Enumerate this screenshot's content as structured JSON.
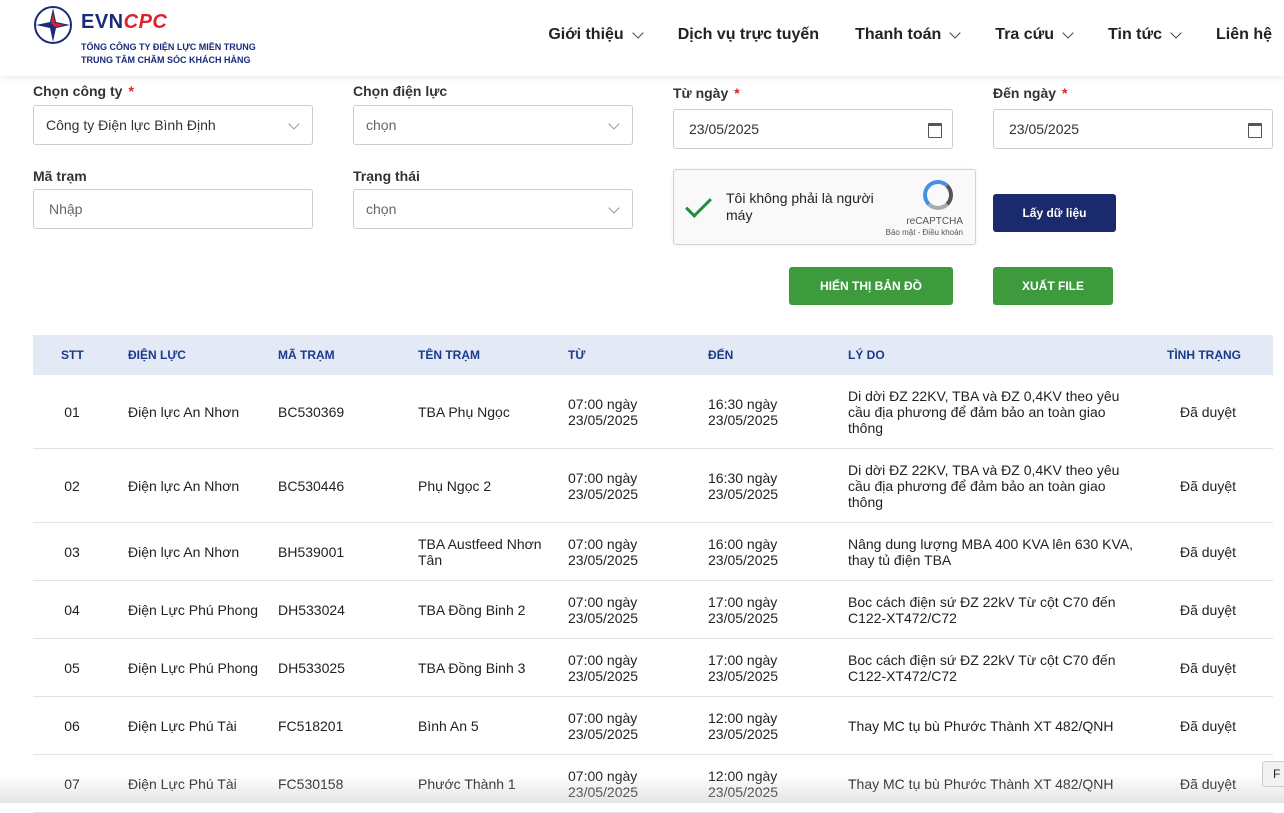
{
  "header": {
    "logo_evn": "EVN",
    "logo_cpc": "CPC",
    "logo_sub1": "TỔNG CÔNG TY ĐIỆN LỰC MIỀN TRUNG",
    "logo_sub2": "TRUNG TÂM CHĂM SÓC KHÁCH HÀNG",
    "nav": [
      {
        "label": "Giới thiệu",
        "dropdown": true
      },
      {
        "label": "Dịch vụ trực tuyến",
        "dropdown": false
      },
      {
        "label": "Thanh toán",
        "dropdown": true
      },
      {
        "label": "Tra cứu",
        "dropdown": true
      },
      {
        "label": "Tin tức",
        "dropdown": true
      },
      {
        "label": "Liên hệ",
        "dropdown": false
      }
    ]
  },
  "filters": {
    "company_label": "Chọn công ty",
    "company_value": "Công ty Điện lực Bình Định",
    "branch_label": "Chọn điện lực",
    "branch_value": "chọn",
    "from_label": "Từ ngày",
    "from_value": "23/05/2025",
    "to_label": "Đến ngày",
    "to_value": "23/05/2025",
    "station_label": "Mã trạm",
    "station_placeholder": "Nhập",
    "status_label": "Trạng thái",
    "status_value": "chọn",
    "required_mark": "*"
  },
  "captcha": {
    "text": "Tôi không phải là người máy",
    "brand": "reCAPTCHA",
    "links": "Bảo mật - Điều khoản"
  },
  "buttons": {
    "fetch": "Lấy dữ liệu",
    "map": "HIỂN THỊ BẢN ĐỒ",
    "export": "XUẤT FILE",
    "corner": "F"
  },
  "table": {
    "headers": [
      "STT",
      "ĐIỆN LỰC",
      "MÃ TRẠM",
      "TÊN TRẠM",
      "TỪ",
      "ĐẾN",
      "LÝ DO",
      "TÌNH TRẠNG"
    ],
    "rows": [
      [
        "01",
        "Điện lực An Nhơn",
        "BC530369",
        "TBA Phụ Ngọc",
        "07:00 ngày 23/05/2025",
        "16:30 ngày 23/05/2025",
        "Di dời ĐZ 22KV, TBA và ĐZ 0,4KV theo yêu cầu địa phương để đảm bảo an toàn giao thông",
        "Đã duyệt"
      ],
      [
        "02",
        "Điện lực An Nhơn",
        "BC530446",
        "Phụ Ngọc 2",
        "07:00 ngày 23/05/2025",
        "16:30 ngày 23/05/2025",
        "Di dời ĐZ 22KV, TBA và ĐZ 0,4KV theo yêu cầu địa phương để đảm bảo an toàn giao thông",
        "Đã duyệt"
      ],
      [
        "03",
        "Điện lực An Nhơn",
        "BH539001",
        "TBA Austfeed Nhơn Tân",
        "07:00 ngày 23/05/2025",
        "16:00 ngày 23/05/2025",
        "Nâng dung lượng MBA 400 KVA lên 630 KVA, thay tủ điện TBA",
        "Đã duyệt"
      ],
      [
        "04",
        "Điện Lực Phú Phong",
        "DH533024",
        "TBA Đồng Binh 2",
        "07:00 ngày 23/05/2025",
        "17:00 ngày 23/05/2025",
        "Boc cách điện sứ ĐZ 22kV Từ cột C70 đến C122-XT472/C72",
        "Đã duyệt"
      ],
      [
        "05",
        "Điện Lực Phú Phong",
        "DH533025",
        "TBA Đồng Binh 3",
        "07:00 ngày 23/05/2025",
        "17:00 ngày 23/05/2025",
        "Boc cách điện sứ ĐZ 22kV Từ cột C70 đến C122-XT472/C72",
        "Đã duyệt"
      ],
      [
        "06",
        "Điện Lực Phú Tài",
        "FC518201",
        "Bình An 5",
        "07:00 ngày 23/05/2025",
        "12:00 ngày 23/05/2025",
        "Thay MC tụ bù Phước Thành XT 482/QNH",
        "Đã duyệt"
      ],
      [
        "07",
        "Điện Lực Phú Tài",
        "FC530158",
        "Phước Thành 1",
        "07:00 ngày 23/05/2025",
        "12:00 ngày 23/05/2025",
        "Thay MC tụ bù Phước Thành XT 482/QNH",
        "Đã duyệt"
      ]
    ]
  }
}
